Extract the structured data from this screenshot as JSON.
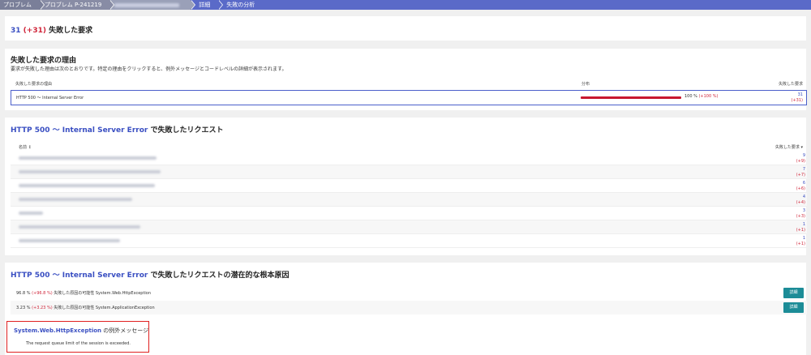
{
  "breadcrumb": {
    "items": [
      "プロブレム",
      "プロブレム P-241219",
      "",
      "詳細",
      "失敗の分析"
    ]
  },
  "summary": {
    "count": "31",
    "delta": "(+31)",
    "label": "失敗した要求"
  },
  "reasons": {
    "title": "失敗した要求の理由",
    "description": "要求が失敗した理由は次のとおりです。特定の理由をクリックすると、例外メッセージとコードレベルの詳細が表示されます。",
    "col_reason": "失敗した要求の理由",
    "col_distribution": "分布",
    "col_failed": "失敗した要求",
    "rows": [
      {
        "label": "HTTP 500 ～ Internal Server Error",
        "percent": "100 %",
        "percent_delta": "(+100 %)",
        "fraction": 1.0,
        "value": "31",
        "delta": "(+31)"
      }
    ]
  },
  "requests": {
    "title_accent": "HTTP 500 ～ Internal Server Error",
    "title_rest": " で失敗したリクエスト",
    "col_name": "名前 ↕",
    "col_failed": "失敗した要求 ▾",
    "rows": [
      {
        "value": "9",
        "delta": "(+9)"
      },
      {
        "value": "7",
        "delta": "(+7)"
      },
      {
        "value": "6",
        "delta": "(+6)"
      },
      {
        "value": "4",
        "delta": "(+4)"
      },
      {
        "value": "3",
        "delta": "(+3)"
      },
      {
        "value": "1",
        "delta": "(+1)"
      },
      {
        "value": "1",
        "delta": "(+1)"
      }
    ]
  },
  "root_causes": {
    "title_accent": "HTTP 500 ～ Internal Server Error",
    "title_rest": " で失敗したリクエストの潜在的な根本原因",
    "items": [
      {
        "percent": "96.8 %",
        "delta": "(+96.8 %)",
        "text": "失敗した原因の可能性 System.Web.HttpException",
        "button": "詳細"
      },
      {
        "percent": "3.23 %",
        "delta": "(+3.23 %)",
        "text": "失敗した原因の可能性 System.ApplicationException",
        "button": "詳細"
      }
    ]
  },
  "exception": {
    "name": "System.Web.HttpException",
    "suffix": " の例外メッセージ",
    "message": "The request queue limit of the session is exceeded."
  },
  "colors": {
    "accent": "#3a4fc2",
    "error_red": "#d0273b",
    "bar_red": "#c7182f",
    "button_teal": "#1c8c97",
    "highlight_border": "#e02020",
    "breadcrumb_bg": "#5a6ac8"
  }
}
